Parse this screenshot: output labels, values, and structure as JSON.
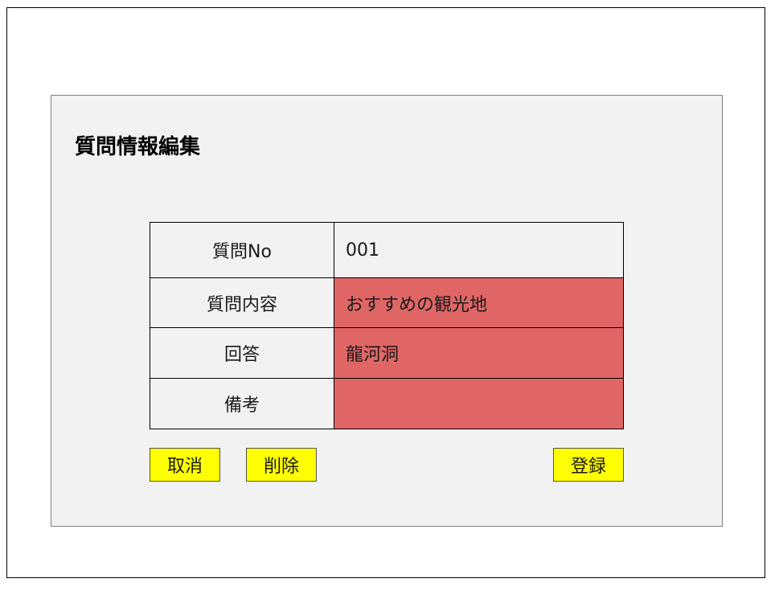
{
  "page": {
    "title": "質問情報編集"
  },
  "form": {
    "rows": [
      {
        "label": "質問No",
        "value": "001",
        "highlighted": false
      },
      {
        "label": "質問内容",
        "value": "おすすめの観光地",
        "highlighted": true
      },
      {
        "label": "回答",
        "value": "龍河洞",
        "highlighted": true
      },
      {
        "label": "備考",
        "value": "",
        "highlighted": true
      }
    ]
  },
  "buttons": {
    "cancel_label": "取消",
    "delete_label": "削除",
    "register_label": "登録"
  },
  "colors": {
    "panel_background": "#f2f2f2",
    "label_cell_background": "#f2f2f2",
    "readonly_value_background": "#f2f2f2",
    "editable_value_background": "#e06666",
    "button_background": "#ffff00"
  }
}
